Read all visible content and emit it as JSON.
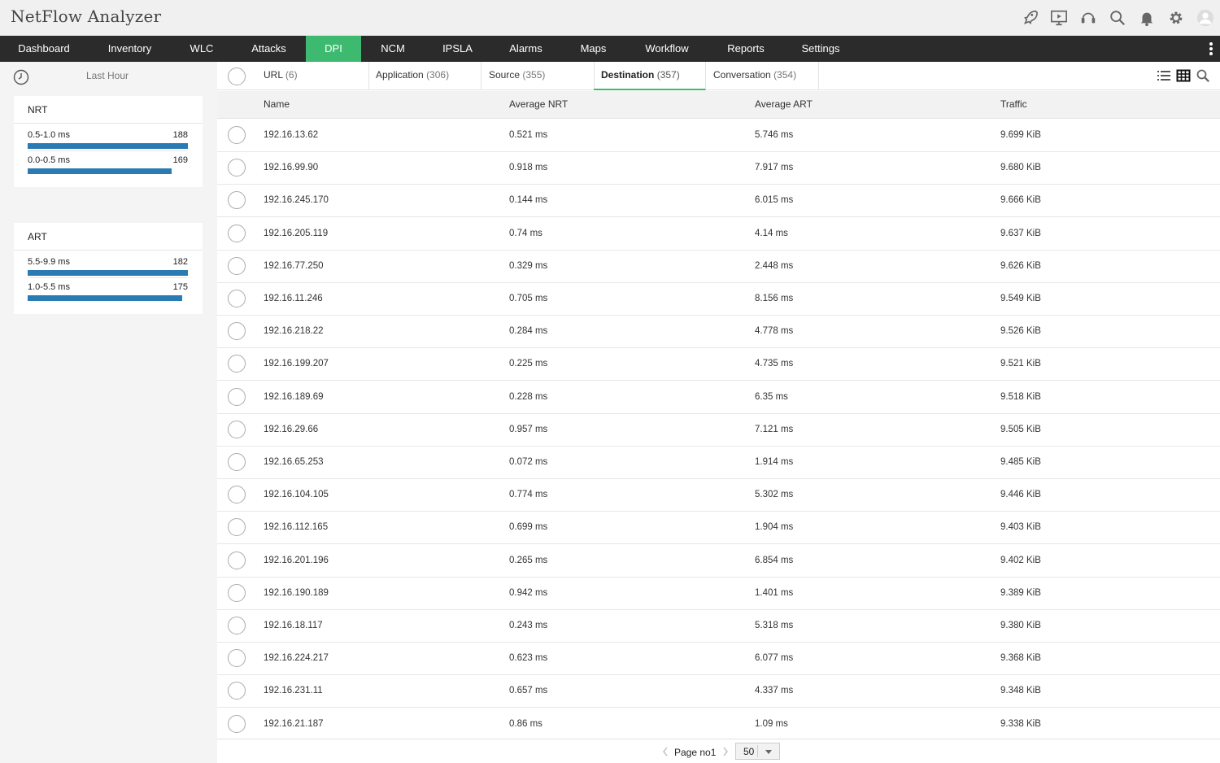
{
  "app": {
    "title": "NetFlow Analyzer"
  },
  "header_icons": [
    "rocket-icon",
    "presentation-icon",
    "headset-icon",
    "search-icon",
    "bell-icon",
    "gear-icon",
    "user-avatar-icon"
  ],
  "nav": {
    "items": [
      {
        "label": "Dashboard",
        "active": false
      },
      {
        "label": "Inventory",
        "active": false
      },
      {
        "label": "WLC",
        "active": false
      },
      {
        "label": "Attacks",
        "active": false
      },
      {
        "label": "DPI",
        "active": true
      },
      {
        "label": "NCM",
        "active": false
      },
      {
        "label": "IPSLA",
        "active": false
      },
      {
        "label": "Alarms",
        "active": false
      },
      {
        "label": "Maps",
        "active": false
      },
      {
        "label": "Workflow",
        "active": false
      },
      {
        "label": "Reports",
        "active": false
      },
      {
        "label": "Settings",
        "active": false
      }
    ]
  },
  "sidebar": {
    "time_label": "Last Hour",
    "nrt": {
      "title": "NRT",
      "rows": [
        {
          "label": "0.5-1.0 ms",
          "value": "188",
          "fraction": 1.0
        },
        {
          "label": "0.0-0.5 ms",
          "value": "169",
          "fraction": 0.899
        }
      ]
    },
    "art": {
      "title": "ART",
      "rows": [
        {
          "label": "5.5-9.9 ms",
          "value": "182",
          "fraction": 1.0
        },
        {
          "label": "1.0-5.5 ms",
          "value": "175",
          "fraction": 0.962
        }
      ]
    },
    "bar_color": "#2a7ab4"
  },
  "tabs": [
    {
      "name": "URL",
      "count": "(6)",
      "active": false
    },
    {
      "name": "Application",
      "count": "(306)",
      "active": false
    },
    {
      "name": "Source",
      "count": "(355)",
      "active": false
    },
    {
      "name": "Destination",
      "count": "(357)",
      "active": true
    },
    {
      "name": "Conversation",
      "count": "(354)",
      "active": false
    }
  ],
  "view_icons": [
    "list-view-icon",
    "grid-view-icon",
    "search-icon"
  ],
  "table": {
    "headers": {
      "name": "Name",
      "nrt": "Average NRT",
      "art": "Average ART",
      "traffic": "Traffic"
    },
    "rows": [
      {
        "name": "192.16.13.62",
        "nrt": "0.521 ms",
        "art": "5.746 ms",
        "traffic": "9.699 KiB"
      },
      {
        "name": "192.16.99.90",
        "nrt": "0.918 ms",
        "art": "7.917 ms",
        "traffic": "9.680 KiB"
      },
      {
        "name": "192.16.245.170",
        "nrt": "0.144 ms",
        "art": "6.015 ms",
        "traffic": "9.666 KiB"
      },
      {
        "name": "192.16.205.119",
        "nrt": "0.74 ms",
        "art": "4.14 ms",
        "traffic": "9.637 KiB"
      },
      {
        "name": "192.16.77.250",
        "nrt": "0.329 ms",
        "art": "2.448 ms",
        "traffic": "9.626 KiB"
      },
      {
        "name": "192.16.11.246",
        "nrt": "0.705 ms",
        "art": "8.156 ms",
        "traffic": "9.549 KiB"
      },
      {
        "name": "192.16.218.22",
        "nrt": "0.284 ms",
        "art": "4.778 ms",
        "traffic": "9.526 KiB"
      },
      {
        "name": "192.16.199.207",
        "nrt": "0.225 ms",
        "art": "4.735 ms",
        "traffic": "9.521 KiB"
      },
      {
        "name": "192.16.189.69",
        "nrt": "0.228 ms",
        "art": "6.35 ms",
        "traffic": "9.518 KiB"
      },
      {
        "name": "192.16.29.66",
        "nrt": "0.957 ms",
        "art": "7.121 ms",
        "traffic": "9.505 KiB"
      },
      {
        "name": "192.16.65.253",
        "nrt": "0.072 ms",
        "art": "1.914 ms",
        "traffic": "9.485 KiB"
      },
      {
        "name": "192.16.104.105",
        "nrt": "0.774 ms",
        "art": "5.302 ms",
        "traffic": "9.446 KiB"
      },
      {
        "name": "192.16.112.165",
        "nrt": "0.699 ms",
        "art": "1.904 ms",
        "traffic": "9.403 KiB"
      },
      {
        "name": "192.16.201.196",
        "nrt": "0.265 ms",
        "art": "6.854 ms",
        "traffic": "9.402 KiB"
      },
      {
        "name": "192.16.190.189",
        "nrt": "0.942 ms",
        "art": "1.401 ms",
        "traffic": "9.389 KiB"
      },
      {
        "name": "192.16.18.117",
        "nrt": "0.243 ms",
        "art": "5.318 ms",
        "traffic": "9.380 KiB"
      },
      {
        "name": "192.16.224.217",
        "nrt": "0.623 ms",
        "art": "6.077 ms",
        "traffic": "9.368 KiB"
      },
      {
        "name": "192.16.231.11",
        "nrt": "0.657 ms",
        "art": "4.337 ms",
        "traffic": "9.348 KiB"
      },
      {
        "name": "192.16.21.187",
        "nrt": "0.86 ms",
        "art": "1.09 ms",
        "traffic": "9.338 KiB"
      }
    ]
  },
  "pager": {
    "label": "Page no1",
    "page_size": "50"
  },
  "colors": {
    "accent": "#3dba6f",
    "nav_bg": "#2b2b2b"
  }
}
